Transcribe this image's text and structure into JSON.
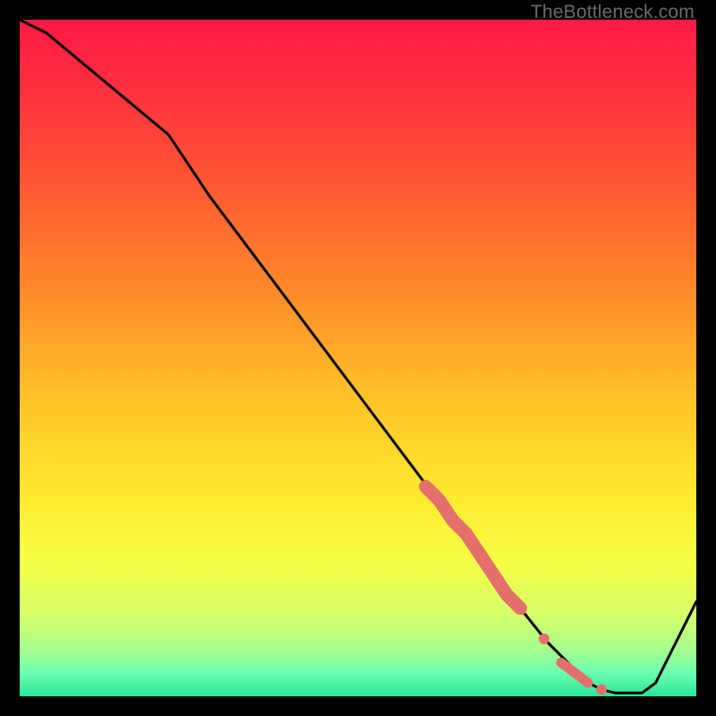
{
  "watermark": "TheBottleneck.com",
  "colors": {
    "curve": "#000000",
    "marker": "#e4706c",
    "gradient_stops": [
      {
        "offset": 0.0,
        "color": "#ff1a44"
      },
      {
        "offset": 0.1,
        "color": "#ff2f3f"
      },
      {
        "offset": 0.25,
        "color": "#ff5a32"
      },
      {
        "offset": 0.4,
        "color": "#ff8a2a"
      },
      {
        "offset": 0.55,
        "color": "#ffc028"
      },
      {
        "offset": 0.7,
        "color": "#ffe92e"
      },
      {
        "offset": 0.8,
        "color": "#f6ff45"
      },
      {
        "offset": 0.88,
        "color": "#d5ff6a"
      },
      {
        "offset": 0.93,
        "color": "#a7ff8e"
      },
      {
        "offset": 0.965,
        "color": "#6dffb0"
      },
      {
        "offset": 1.0,
        "color": "#28e59a"
      }
    ]
  },
  "chart_data": {
    "type": "line",
    "title": "",
    "xlabel": "",
    "ylabel": "",
    "xlim": [
      0,
      100
    ],
    "ylim": [
      0,
      100
    ],
    "grid": false,
    "legend": false,
    "series": [
      {
        "name": "bottleneck-curve",
        "x": [
          0,
          4,
          10,
          16,
          22,
          24,
          28,
          34,
          40,
          46,
          52,
          58,
          64,
          70,
          74,
          78,
          80,
          82,
          84,
          86,
          88,
          90,
          92,
          94,
          96,
          98,
          100
        ],
        "y": [
          100,
          98,
          93,
          88,
          83,
          80,
          74,
          66,
          58,
          50,
          42,
          34,
          26,
          18,
          13,
          8,
          6,
          4,
          2,
          1,
          0.5,
          0.5,
          0.5,
          2,
          6,
          10,
          14
        ]
      }
    ],
    "markers": [
      {
        "name": "highlight-segment",
        "kind": "thick",
        "x": [
          60,
          62,
          64,
          66,
          68,
          70,
          72,
          74
        ],
        "y": [
          31,
          29,
          26,
          24,
          21,
          18,
          15,
          13
        ]
      },
      {
        "name": "dot-a",
        "kind": "dot",
        "x": 77.5,
        "y": 8.5
      },
      {
        "name": "dot-pair",
        "kind": "dash",
        "x": [
          80,
          84
        ],
        "y": [
          5,
          2
        ]
      },
      {
        "name": "dot-b",
        "kind": "dot",
        "x": 86,
        "y": 1
      }
    ]
  }
}
